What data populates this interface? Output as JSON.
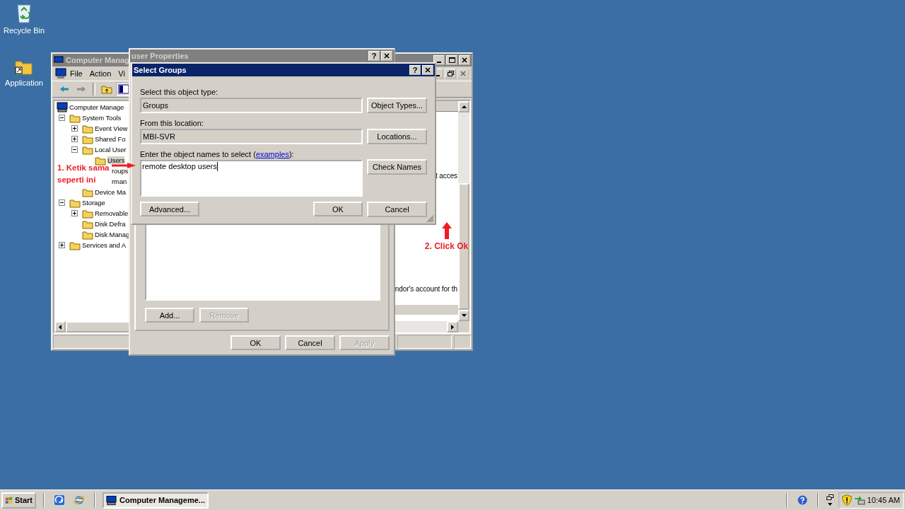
{
  "desktop_icons": [
    {
      "label": "Recycle Bin"
    },
    {
      "label": "Application"
    }
  ],
  "computer_management": {
    "title": "Computer Manag",
    "menu": [
      "File",
      "Action",
      "Vi"
    ],
    "tree": [
      {
        "label": "Computer Manage",
        "kind": "node",
        "selected": false,
        "children": [
          {
            "label": "System Tools",
            "kind": "node",
            "selected": false,
            "expanded": true,
            "children": [
              {
                "label": "Event View",
                "kind": "node",
                "selected": false,
                "expanded": false
              },
              {
                "label": "Shared Fo",
                "kind": "node",
                "selected": false,
                "expanded": false
              },
              {
                "label": "Local User",
                "kind": "node",
                "selected": false,
                "expanded": true,
                "children": [
                  {
                    "label": "Users",
                    "kind": "node",
                    "selected": true
                  },
                  {
                    "label": "roups",
                    "kind": "covered",
                    "selected": false
                  }
                ]
              },
              {
                "label": "rman",
                "kind": "covered",
                "selected": false
              },
              {
                "label": "Device Ma",
                "kind": "node",
                "selected": false
              }
            ]
          },
          {
            "label": "Storage",
            "kind": "node",
            "selected": false,
            "expanded": true,
            "children": [
              {
                "label": "Removable",
                "kind": "node",
                "selected": false,
                "expanded": false
              },
              {
                "label": "Disk Defra",
                "kind": "node",
                "selected": false
              },
              {
                "label": "Disk Manag",
                "kind": "node",
                "selected": false
              }
            ]
          },
          {
            "label": "Services and A",
            "kind": "node",
            "selected": false,
            "expanded": false
          }
        ]
      }
    ],
    "list_rows": [
      {
        "column_3": "t acces"
      },
      {
        "column_3": "ndor's account for th"
      }
    ]
  },
  "user_properties": {
    "title": "user Properties",
    "help_glyph": "?",
    "member_buttons": [
      {
        "label": "Add...",
        "disabled": false
      },
      {
        "label": "Remove",
        "disabled": true
      }
    ],
    "buttons": [
      {
        "label": "OK",
        "disabled": false
      },
      {
        "label": "Cancel",
        "disabled": false
      },
      {
        "label": "Apply",
        "disabled": true
      }
    ]
  },
  "select_groups": {
    "title": "Select Groups",
    "help_glyph": "?",
    "object_type_label": "Select this object type:",
    "object_type": "Groups",
    "object_types_button": "Object Types...",
    "location_label": "From this location:",
    "location": "MBI-SVR",
    "locations_button": "Locations...",
    "names_label_before": "Enter the object names to select (",
    "names_link": "examples",
    "names_label_after": "):",
    "names_value": "remote desktop users",
    "check_names_button": "Check Names",
    "advanced_button": "Advanced...",
    "ok_button": "OK",
    "cancel_button": "Cancel"
  },
  "annotations": [
    {
      "kind": "right",
      "text": "1. Ketik sama seperti ini"
    },
    {
      "kind": "up",
      "text": "2. Click Ok"
    }
  ],
  "taskbar": {
    "start": "Start",
    "tasks": [
      {
        "label": "Computer Manageme...",
        "selected": true
      }
    ],
    "clock": "10:45 AM"
  }
}
